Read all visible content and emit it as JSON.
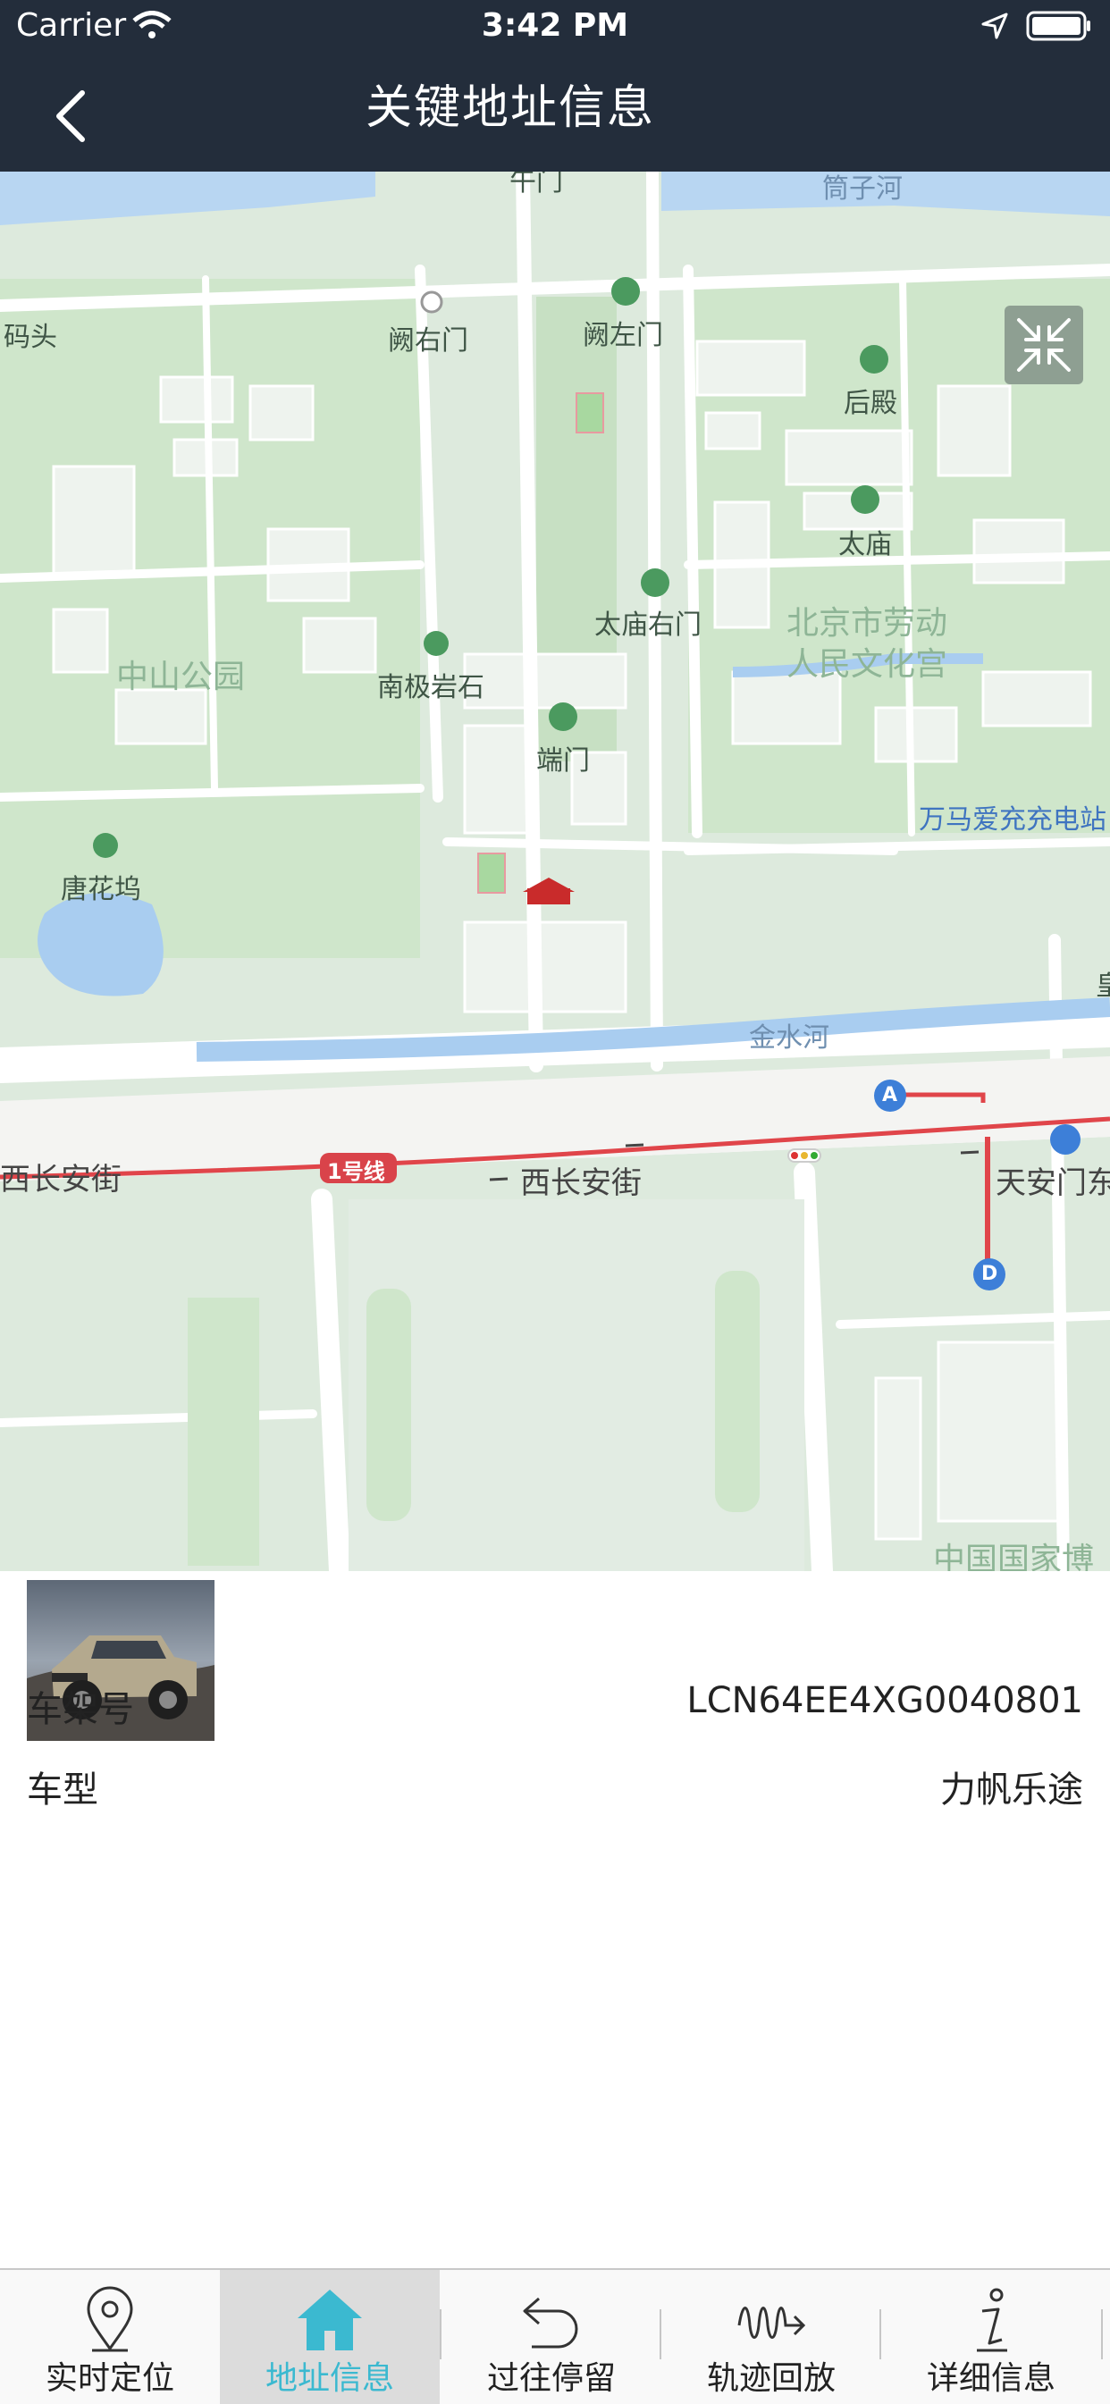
{
  "status_bar": {
    "carrier": "Carrier",
    "time": "3:42 PM"
  },
  "nav": {
    "title": "关键地址信息"
  },
  "map": {
    "labels": {
      "yongdingmen_pier": "码头",
      "queyoumen": "阙右门",
      "quezuomen": "阙左门",
      "houdian": "后殿",
      "taimiao": "太庙",
      "taimiao_youmen": "太庙右门",
      "workers_palace_1": "北京市劳动",
      "workers_palace_2": "人民文化宫",
      "zhongshan_park": "中山公园",
      "nanjiyanshi": "南极岩石",
      "duanmen": "端门",
      "tanghuawu": "唐花坞",
      "charging": "万马爱充充电站",
      "jinshuihe": "金水河",
      "xichanganjie_left": "西长安街",
      "xichanganjie_right": "西长安街",
      "line1": "1号线",
      "tiananmen_east": "天安门东",
      "museum": "中国国家博",
      "tongzihe": "筒子河",
      "top_gate": "午门",
      "station_a": "A",
      "station_d": "D",
      "right_edge_char": "皇"
    }
  },
  "vehicle": {
    "vin_label": "车架号",
    "vin_value": "LCN64EE4XG0040801",
    "model_label": "车型",
    "model_value": "力帆乐途"
  },
  "tabs": [
    {
      "label": "实时定位",
      "icon": "location-pin-icon",
      "active": false
    },
    {
      "label": "地址信息",
      "icon": "home-icon",
      "active": true
    },
    {
      "label": "过往停留",
      "icon": "undo-arrow-icon",
      "active": false
    },
    {
      "label": "轨迹回放",
      "icon": "track-playback-icon",
      "active": false
    },
    {
      "label": "详细信息",
      "icon": "info-icon",
      "active": false
    }
  ],
  "colors": {
    "header_bg": "#232d3b",
    "accent": "#3bb9d0",
    "map_bg": "#ddeadd",
    "metro_line": "#e0454a"
  }
}
